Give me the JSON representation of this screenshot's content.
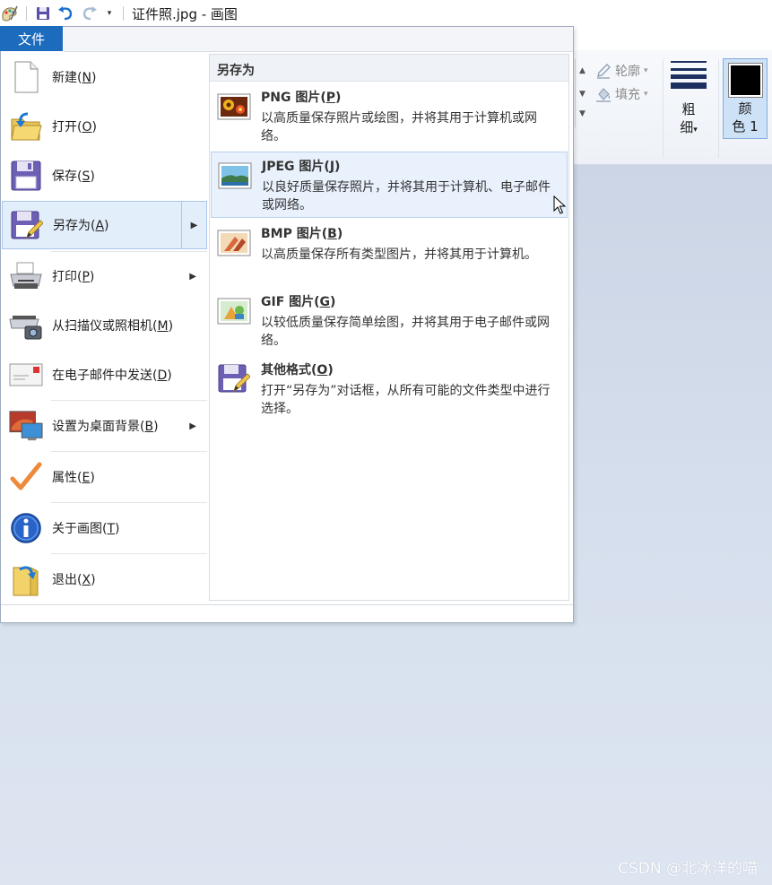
{
  "window": {
    "title": "证件照.jpg - 画图"
  },
  "file_tab": {
    "label": "文件"
  },
  "left_menu": {
    "items": [
      {
        "label": "新建",
        "key": "N",
        "icon": "new-document-icon"
      },
      {
        "label": "打开",
        "key": "O",
        "icon": "open-folder-icon"
      },
      {
        "label": "保存",
        "key": "S",
        "icon": "save-disk-icon"
      },
      {
        "label": "另存为",
        "key": "A",
        "icon": "save-as-icon",
        "selected": true
      },
      {
        "label": "打印",
        "key": "P",
        "icon": "printer-icon"
      },
      {
        "label": "从扫描仪或照相机",
        "key": "M",
        "icon": "scanner-camera-icon"
      },
      {
        "label": "在电子邮件中发送",
        "key": "D",
        "icon": "email-icon"
      },
      {
        "label": "设置为桌面背景",
        "key": "B",
        "icon": "desktop-background-icon"
      },
      {
        "label": "属性",
        "key": "E",
        "icon": "properties-check-icon"
      },
      {
        "label": "关于画图",
        "key": "T",
        "icon": "info-icon"
      },
      {
        "label": "退出",
        "key": "X",
        "icon": "exit-icon"
      }
    ]
  },
  "save_as_pane": {
    "header": "另存为",
    "options": [
      {
        "title": "PNG 图片",
        "key": "P",
        "desc": "以高质量保存照片或绘图，并将其用于计算机或网络。",
        "icon": "png-image-icon"
      },
      {
        "title": "JPEG 图片",
        "key": "J",
        "desc": "以良好质量保存照片，并将其用于计算机、电子邮件或网络。",
        "icon": "jpeg-image-icon",
        "hovered": true
      },
      {
        "title": "BMP 图片",
        "key": "B",
        "desc": "以高质量保存所有类型图片，并将其用于计算机。",
        "icon": "bmp-image-icon"
      },
      {
        "title": "GIF 图片",
        "key": "G",
        "desc": "以较低质量保存简单绘图，并将其用于电子邮件或网络。",
        "icon": "gif-image-icon"
      },
      {
        "title": "其他格式",
        "key": "O",
        "desc": "打开“另存为”对话框，从所有可能的文件类型中进行选择。",
        "icon": "other-formats-icon"
      }
    ]
  },
  "ribbon": {
    "outline_label": "轮廓",
    "fill_label": "填充",
    "thickness_label_1": "粗",
    "thickness_label_2": "细",
    "color1_label_1": "颜",
    "color1_label_2": "色 1",
    "color1_value": "#000000"
  },
  "watermark": "CSDN @北冰洋的喵"
}
